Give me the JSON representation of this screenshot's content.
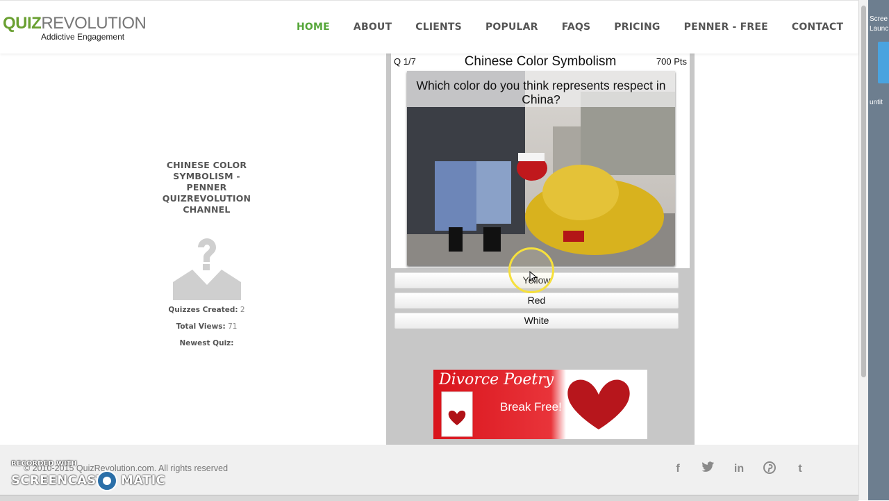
{
  "header": {
    "logo_quiz": "QUIZ",
    "logo_revolution": "REVOLUTION",
    "tagline": "Addictive Engagement",
    "nav": [
      {
        "label": "HOME",
        "active": true
      },
      {
        "label": "ABOUT"
      },
      {
        "label": "CLIENTS"
      },
      {
        "label": "POPULAR"
      },
      {
        "label": "FAQS"
      },
      {
        "label": "PRICING"
      },
      {
        "label": "PENNER - FREE"
      },
      {
        "label": "CONTACT"
      }
    ]
  },
  "channel": {
    "title": "CHINESE COLOR SYMBOLISM - PENNER QUIZREVOLUTION CHANNEL",
    "avatar_icon": "user-placeholder-icon",
    "quizzes_created_label": "Quizzes Created:",
    "quizzes_created_value": "2",
    "total_views_label": "Total Views:",
    "total_views_value": "71",
    "newest_quiz_label": "Newest Quiz:"
  },
  "quiz": {
    "progress": "Q 1/7",
    "title": "Chinese Color Symbolism",
    "points": "700 Pts",
    "question": "Which color do you think represents respect in China?",
    "answers": [
      "Yellow",
      "Red",
      "White"
    ]
  },
  "ad": {
    "title": "Divorce Poetry",
    "subtitle": "Break Free!"
  },
  "footer": {
    "copyright": "© 2010-2015 QuizRevolution.com. All rights reserved",
    "social": [
      "facebook-icon",
      "twitter-icon",
      "linkedin-icon",
      "pinterest-icon",
      "tumblr-icon"
    ]
  },
  "watermark": {
    "line1": "RECORDED WITH",
    "line2a": "SCREENCAST",
    "line2b": "MATIC"
  },
  "desktop": {
    "label1": "Scree",
    "label2": "Launc",
    "label3": "untit"
  },
  "colors": {
    "accent_green": "#55a638",
    "panel_gray": "#c7c7c7",
    "ad_red": "#d9141c"
  }
}
